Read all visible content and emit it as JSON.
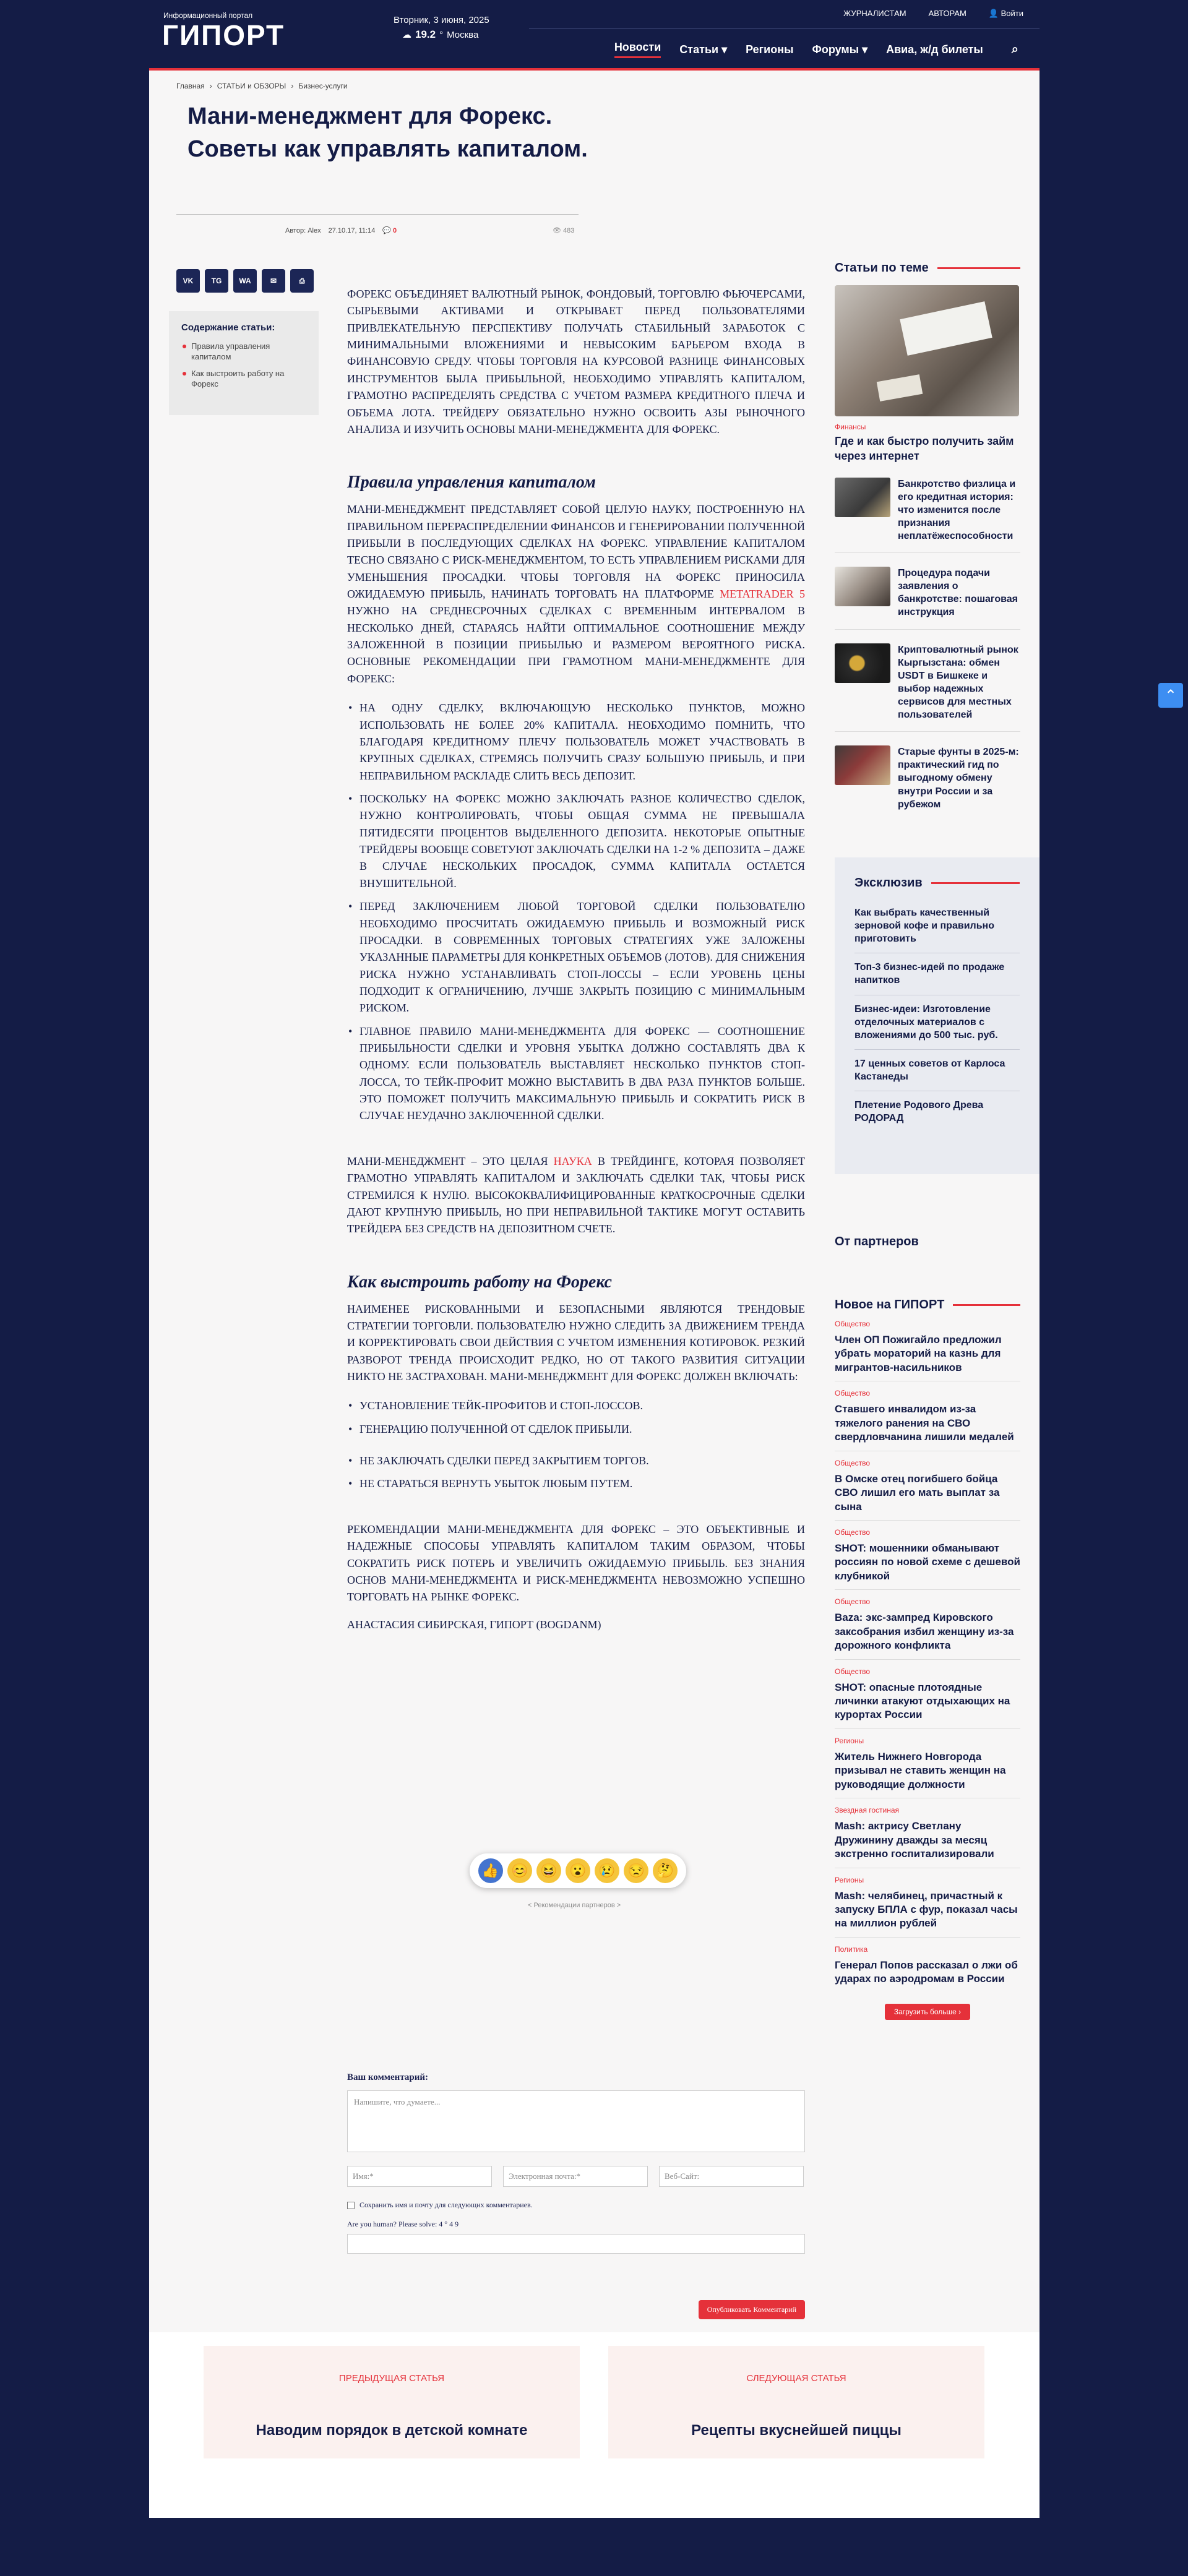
{
  "header": {
    "portal_tag": "Информационный портал",
    "logo": "ГИПОРТ",
    "date": "Вторник, 3 июня, 2025",
    "temperature": "19.2",
    "temp_unit": "°",
    "city": "Москва",
    "top_links": [
      "ЖУРНАЛИСТАМ",
      "АВТОРАМ",
      "Войти"
    ],
    "nav": [
      "Новости",
      "Статьи ▾",
      "Регионы",
      "Форумы ▾",
      "Авиа, ж/д билеты"
    ]
  },
  "breadcrumbs": [
    "Главная",
    "›",
    "СТАТЬИ и ОБЗОРЫ",
    "›",
    "Бизнес-услуги"
  ],
  "article": {
    "title": "Мани-менеджмент для Форекс. Советы как управлять капиталом.",
    "author_label": "Автор:",
    "author": "Alex",
    "datetime": "27.10.17, 11:14",
    "comments": "0",
    "views": "483",
    "intro": "Форекс объединяет валютный рынок, фондовый, торговлю фьючерсами, сырьевыми активами и открывает перед пользователями привлекательную перспективу получать стабильный заработок с минимальными вложениями и невысоким барьером входа в финансовую среду. Чтобы торговля на курсовой разнице финансовых инструментов была прибыльной, необходимо управлять капиталом, грамотно распределять средства с учетом размера кредитного плеча и объема лота. Трейдеру обязательно нужно освоить азы рыночного анализа и изучить основы мани-менеджмента для Форекс.",
    "h1": "Правила управления капиталом",
    "p1_a": "Мани-менеджмент представляет собой целую науку, построенную на правильном перераспределении финансов и генерировании полученной прибыли в последующих сделках на Форекс. Управление капиталом тесно связано с риск-менеджментом, то есть управлением рисками для уменьшения просадки. Чтобы торговля на Форекс приносила ожидаемую прибыль, начинать торговать на платформе ",
    "p1_link": "MetaTrader 5",
    "p1_b": " нужно на среднесрочных сделках с временным интервалом в несколько дней, стараясь найти оптимальное соотношение между заложенной в позиции прибылью и размером вероятного риска. Основные рекомендации при грамотном мани-менеджменте для Форекс:",
    "list1": [
      "На одну сделку, включающую несколько пунктов, можно использовать не более 20% капитала. Необходимо помнить, что благодаря кредитному плечу пользователь может участвовать в крупных сделках, стремясь получить сразу большую прибыль, и при неправильном раскладе слить весь депозит.",
      "Поскольку на Форекс можно заключать разное количество сделок, нужно контролировать, чтобы общая сумма не превышала пятидесяти процентов выделенного депозита. Некоторые опытные трейдеры вообще советуют заключать сделки на 1-2 % депозита – даже в случае нескольких просадок, сумма капитала остается внушительной.",
      "Перед заключением любой торговой сделки пользователю необходимо просчитать ожидаемую прибыль и возможный риск просадки. В современных торговых стратегиях уже заложены указанные параметры для конкретных объемов (лотов). Для снижения риска нужно устанавливать стоп-лоссы – если уровень цены подходит к ограничению, лучше закрыть позицию с минимальным риском.",
      "Главное правило мани-менеджмента для Форекс — соотношение прибыльности сделки и уровня убытка должно составлять два к одному. Если пользователь выставляет несколько пунктов стоп-лосса, то тейк-профит можно выставить в два раза пунктов больше. Это поможет получить максимальную прибыль и сократить риск в случае неудачно заключенной сделки."
    ],
    "p2_a": "Мани-менеджмент – это целая ",
    "p2_link": "наука",
    "p2_b": " в трейдинге, которая позволяет грамотно управлять капиталом и заключать сделки так, чтобы риск стремился к нулю. Высококвалифицированные краткосрочные сделки дают крупную прибыль, но при неправильной тактике могут оставить трейдера без средств на депозитном счете.",
    "h2": "Как выстроить работу на Форекс",
    "p3": "Наименее рискованными и безопасными являются трендовые стратегии торговли. Пользователю нужно следить за движением тренда и корректировать свои действия с учетом изменения котировок. Резкий разворот тренда происходит редко, но от такого развития ситуации никто не застрахован. Мани-менеджмент для Форекс должен включать:",
    "list2": [
      "установление тейк-профитов и стоп-лоссов.",
      "генерацию полученной от сделок прибыли.",
      "не заключать сделки перед закрытием торгов.",
      "не стараться вернуть убыток любым путем."
    ],
    "p4": "Рекомендации мани-менеджмента для Форекс – это объективные и надежные способы управлять капиталом таким образом, чтобы сократить риск потерь и увеличить ожидаемую прибыль. Без знания основ мани-менеджмента и риск-менеджмента невозможно успешно торговать на рынке Форекс.",
    "signature": "Анастасия Сибирская, ГИПОРТ (BOGDANM)"
  },
  "share_buttons": [
    "VK",
    "TG",
    "WA",
    "✉",
    "⎙"
  ],
  "toc": {
    "title": "Содержание статьи:",
    "items": [
      "Правила управления капиталом",
      "Как выстроить работу на Форекс"
    ]
  },
  "reactions": [
    "👍",
    "😊",
    "😆",
    "😮",
    "😢",
    "😒",
    "🤔"
  ],
  "partner_recs": "< Рекомендации партнеров >",
  "comment_form": {
    "title": "Ваш комментарий:",
    "textarea_placeholder": "Напишите, что думаете...",
    "name_placeholder": "Имя:*",
    "email_placeholder": "Электронная почта:*",
    "site_placeholder": "Веб-Сайт:",
    "save_label": "Сохранить имя и почту для следующих комментариев.",
    "captcha": "Are you human? Please solve: 4 ° 4 9",
    "submit": "Опубликовать Комментарий"
  },
  "post_nav": {
    "prev_label": "ПРЕДЫДУЩАЯ СТАТЬЯ",
    "prev_title": "Наводим порядок в детской комнате",
    "next_label": "СЛЕДУЮЩАЯ СТАТЬЯ",
    "next_title": "Рецепты вкуснейшей пиццы"
  },
  "sidebar": {
    "related_title": "Статьи по теме",
    "hero_cat": "Финансы",
    "hero_title": "Где и как быстро получить займ через интернет",
    "items": [
      "Банкротство физлица и его кредитная история: что изменится после признания неплатёжеспособности",
      "Процедура подачи заявления о банкротстве: пошаговая инструкция",
      "Криптовалютный рынок Кыргызстана: обмен USDT в Бишкеке и выбор надежных сервисов для местных пользователей",
      "Старые фунты в 2025-м: практический гид по выгодному обмену внутри России и за рубежом"
    ],
    "exclusive_title": "Эксклюзив",
    "exclusive": [
      "Как выбрать качественный зерновой кофе и правильно приготовить",
      "Топ-3 бизнес-идей по продаже напитков",
      "Бизнес-идеи: Изготовление отделочных материалов с вложениями до 500 тыс. руб.",
      "17 ценных советов от Карлоса Кастанеды",
      "Плетение Родового Древа РОДОРАД"
    ],
    "partners_title": "От партнеров",
    "new_title": "Новое на ГИПОРТ",
    "news": [
      {
        "cat": "Общество",
        "title": "Член ОП Пожигайло предложил убрать мораторий на казнь для мигрантов-насильников"
      },
      {
        "cat": "Общество",
        "title": "Ставшего инвалидом из-за тяжелого ранения на СВО свердловчанина лишили медалей"
      },
      {
        "cat": "Общество",
        "title": "В Омске отец погибшего бойца СВО лишил его мать выплат за сына"
      },
      {
        "cat": "Общество",
        "title": "SHOT: мошенники обманывают россиян по новой схеме с дешевой клубникой"
      },
      {
        "cat": "Общество",
        "title": "Baza: экс-зампред Кировского заксобрания избил женщину из-за дорожного конфликта"
      },
      {
        "cat": "Общество",
        "title": "SHOT: опасные плотоядные личинки атакуют отдыхающих на курортах России"
      },
      {
        "cat": "Регионы",
        "title": "Житель Нижнего Новгорода призывал не ставить женщин на руководящие должности"
      },
      {
        "cat": "Звездная гостиная",
        "title": "Mash: актрису Светлану Дружинину дважды за месяц экстренно госпитализировали"
      },
      {
        "cat": "Регионы",
        "title": "Mash: челябинец, причастный к запуску БПЛА с фур, показал часы на миллион рублей"
      },
      {
        "cat": "Политика",
        "title": "Генерал Попов рассказал о лжи об ударах по аэродромам в России"
      }
    ],
    "load_more": "Загрузить больше ›"
  }
}
